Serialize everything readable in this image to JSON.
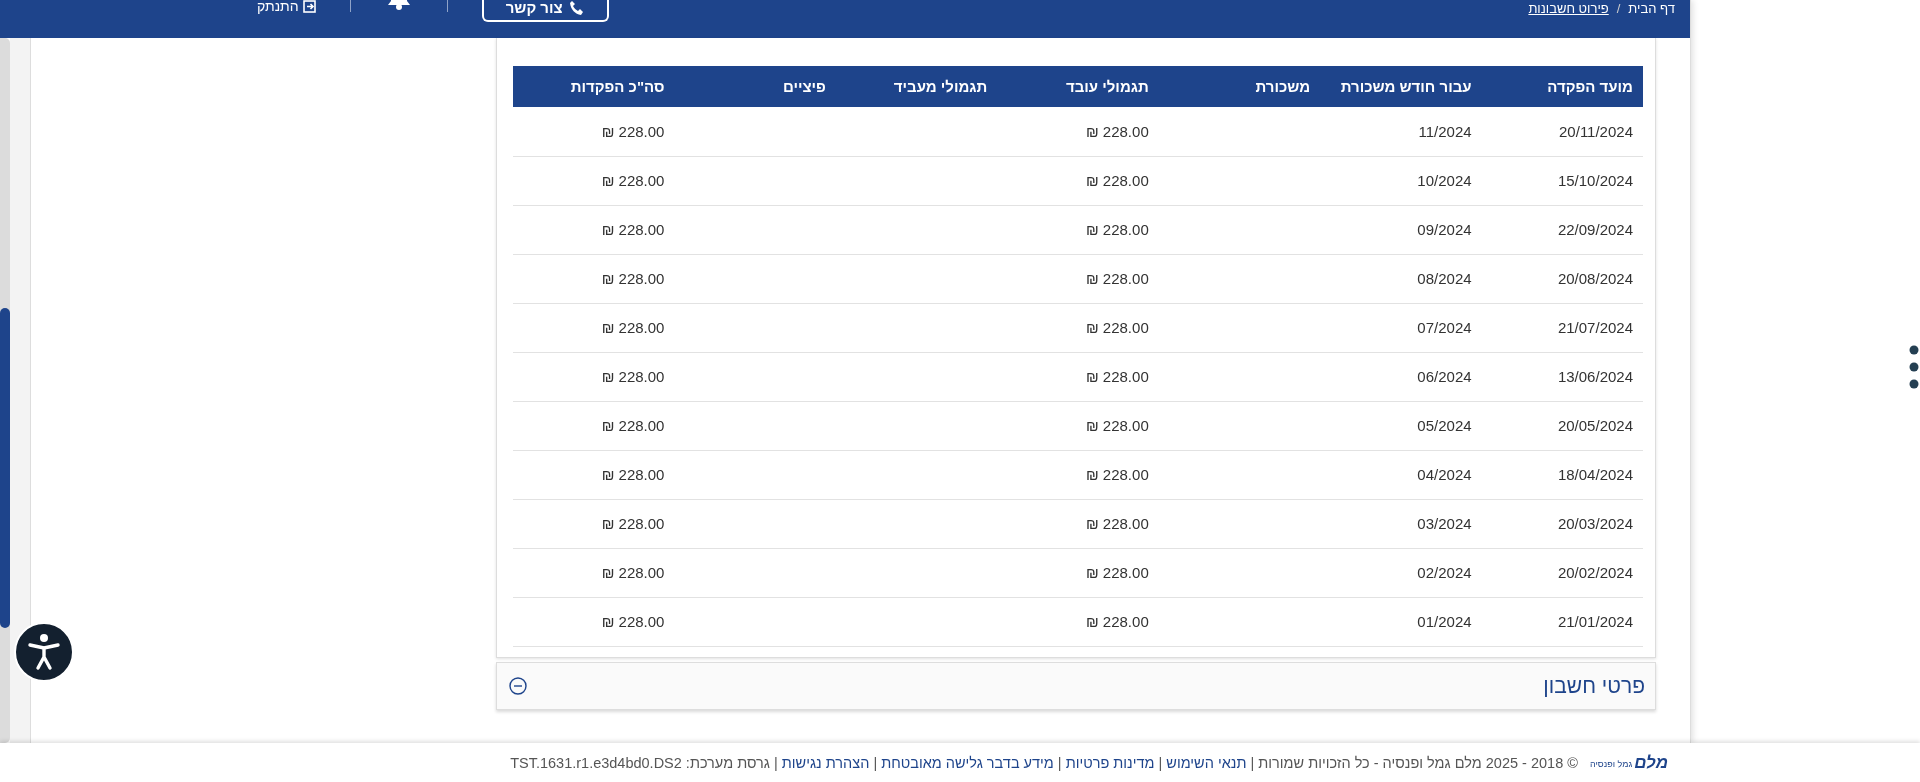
{
  "header": {
    "breadcrumb_separator": "/",
    "breadcrumbs": [
      {
        "label": "דף הבית",
        "link": false
      },
      {
        "label": "פירוט חשבונות",
        "link": true
      }
    ],
    "contact_button": "צור קשר",
    "logout": "התנתק"
  },
  "table": {
    "columns": [
      "מועד הפקדה",
      "עבור חודש משכורת",
      "משכורת",
      "תגמולי עובד",
      "תגמולי מעביד",
      "פיציים",
      "סה\"כ הפקדות"
    ],
    "rows": [
      {
        "deposit_date": "20/11/2024",
        "salary_month": "11/2024",
        "employee_contributions": "228.00 ₪",
        "total_deposits": "228.00 ₪"
      },
      {
        "deposit_date": "15/10/2024",
        "salary_month": "10/2024",
        "employee_contributions": "228.00 ₪",
        "total_deposits": "228.00 ₪"
      },
      {
        "deposit_date": "22/09/2024",
        "salary_month": "09/2024",
        "employee_contributions": "228.00 ₪",
        "total_deposits": "228.00 ₪"
      },
      {
        "deposit_date": "20/08/2024",
        "salary_month": "08/2024",
        "employee_contributions": "228.00 ₪",
        "total_deposits": "228.00 ₪"
      },
      {
        "deposit_date": "21/07/2024",
        "salary_month": "07/2024",
        "employee_contributions": "228.00 ₪",
        "total_deposits": "228.00 ₪"
      },
      {
        "deposit_date": "13/06/2024",
        "salary_month": "06/2024",
        "employee_contributions": "228.00 ₪",
        "total_deposits": "228.00 ₪"
      },
      {
        "deposit_date": "20/05/2024",
        "salary_month": "05/2024",
        "employee_contributions": "228.00 ₪",
        "total_deposits": "228.00 ₪"
      },
      {
        "deposit_date": "18/04/2024",
        "salary_month": "04/2024",
        "employee_contributions": "228.00 ₪",
        "total_deposits": "228.00 ₪"
      },
      {
        "deposit_date": "20/03/2024",
        "salary_month": "03/2024",
        "employee_contributions": "228.00 ₪",
        "total_deposits": "228.00 ₪"
      },
      {
        "deposit_date": "20/02/2024",
        "salary_month": "02/2024",
        "employee_contributions": "228.00 ₪",
        "total_deposits": "228.00 ₪"
      },
      {
        "deposit_date": "21/01/2024",
        "salary_month": "01/2024",
        "employee_contributions": "228.00 ₪",
        "total_deposits": "228.00 ₪"
      }
    ]
  },
  "sections": [
    {
      "title": "פרטי חשבון"
    }
  ],
  "footer": {
    "logo": {
      "name": "מלם",
      "subtitle": "גמל ופנסיה"
    },
    "parts": [
      {
        "kind": "text",
        "text": "© 2018 - 2025 מלם גמל ופנסיה - כל הזכויות שמורות |"
      },
      {
        "kind": "link",
        "text": "תנאי השימוש"
      },
      {
        "kind": "text",
        "text": "|"
      },
      {
        "kind": "link",
        "text": "מדינות פרטיות"
      },
      {
        "kind": "text",
        "text": "|"
      },
      {
        "kind": "link",
        "text": "מידע בדבר גלישה מאובטחת"
      },
      {
        "kind": "text",
        "text": "|"
      },
      {
        "kind": "link",
        "text": "הצהרת נגישות"
      },
      {
        "kind": "text",
        "text": "| גרסת מערכת: TST.1631.r1.e3d4bd0.DS2"
      }
    ]
  }
}
